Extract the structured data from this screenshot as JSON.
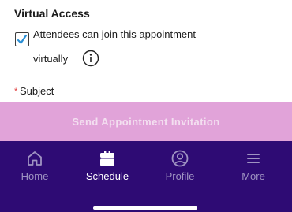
{
  "virtual_access": {
    "title": "Virtual Access",
    "checkbox_checked": true,
    "checkbox_label_line1": "Attendees can join this appointment",
    "checkbox_label_line2": "virtually",
    "info_icon": "info-icon"
  },
  "subject": {
    "required_marker": "*",
    "label": "Subject"
  },
  "send_button": {
    "label": "Send Appointment Invitation"
  },
  "bottom_nav": {
    "items": [
      {
        "label": "Home",
        "icon": "home-icon",
        "active": false
      },
      {
        "label": "Schedule",
        "icon": "calendar-icon",
        "active": true
      },
      {
        "label": "Profile",
        "icon": "profile-icon",
        "active": false
      },
      {
        "label": "More",
        "icon": "menu-icon",
        "active": false
      }
    ]
  },
  "colors": {
    "nav_background": "#2e0b74",
    "button_background": "#e1a3d9",
    "checkbox_check": "#2a8fd6",
    "required_star": "#e03a3a"
  }
}
